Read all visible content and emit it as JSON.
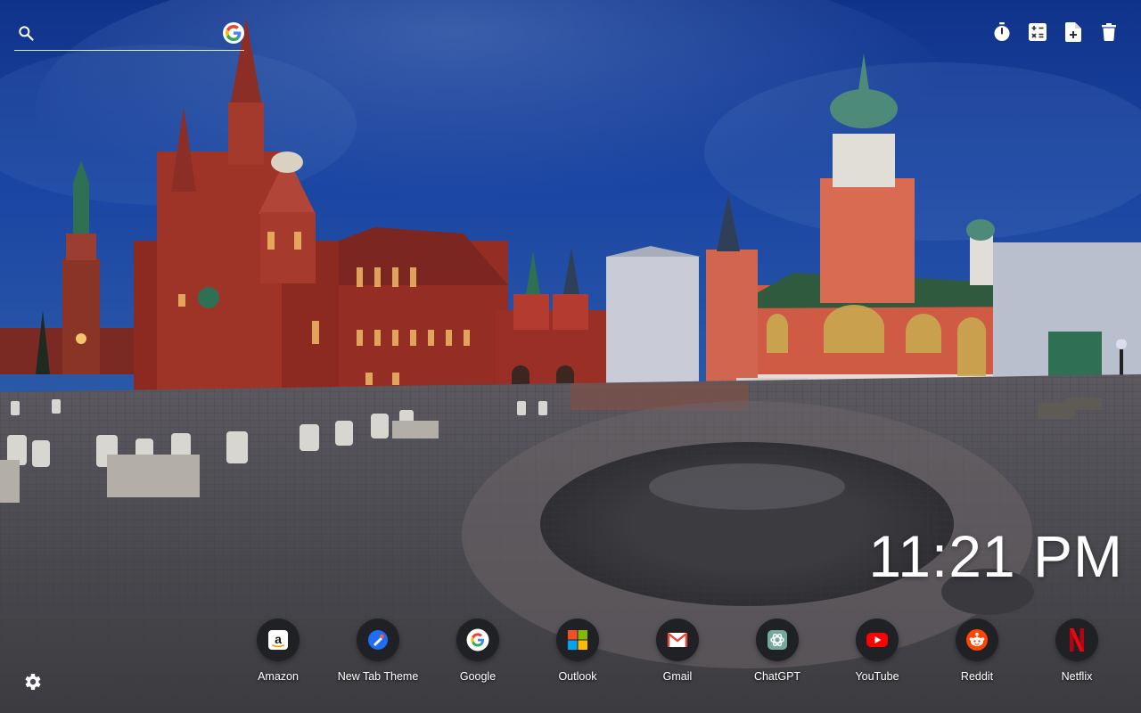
{
  "background": {
    "description": "",
    "sky_color": "#1a3f8f",
    "ground_color": "#4d4c52"
  },
  "search": {
    "placeholder": "",
    "value": "",
    "engine_icon": "google-g-icon"
  },
  "toolbar": [
    {
      "name": "timer",
      "icon": "stopwatch-icon"
    },
    {
      "name": "calculator",
      "icon": "calculator-icon"
    },
    {
      "name": "new-note",
      "icon": "file-plus-icon"
    },
    {
      "name": "delete",
      "icon": "trash-icon"
    }
  ],
  "clock": {
    "time": "11:21 PM"
  },
  "shortcuts": [
    {
      "label": "Amazon",
      "icon": "amazon-icon"
    },
    {
      "label": "New Tab Theme",
      "icon": "new-tab-theme-icon"
    },
    {
      "label": "Google",
      "icon": "google-icon"
    },
    {
      "label": "Outlook",
      "icon": "microsoft-icon"
    },
    {
      "label": "Gmail",
      "icon": "gmail-icon"
    },
    {
      "label": "ChatGPT",
      "icon": "chatgpt-icon"
    },
    {
      "label": "YouTube",
      "icon": "youtube-icon"
    },
    {
      "label": "Reddit",
      "icon": "reddit-icon"
    },
    {
      "label": "Netflix",
      "icon": "netflix-icon"
    }
  ],
  "settings": {
    "icon": "gear-icon"
  }
}
